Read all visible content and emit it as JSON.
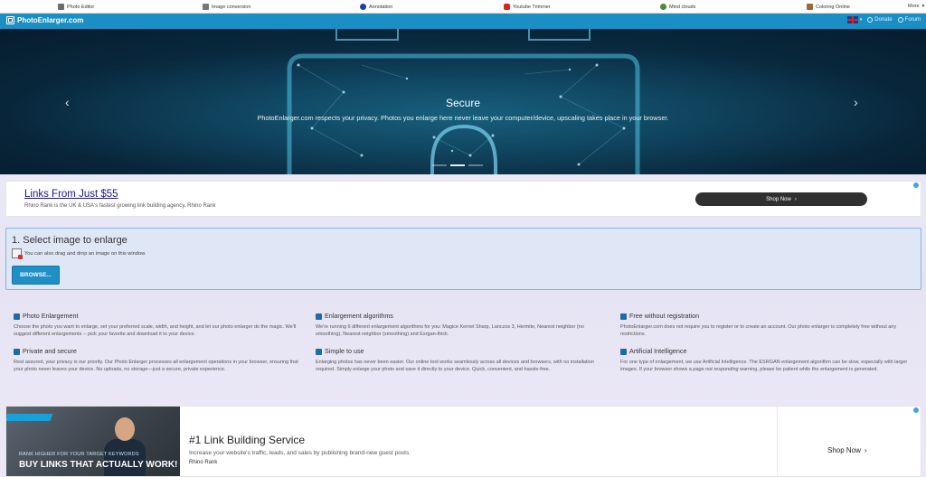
{
  "topbar": {
    "items": [
      {
        "label": "Photo Editor",
        "icon": "photo-editor-icon",
        "color": "#6d6d6d"
      },
      {
        "label": "Image conversion",
        "icon": "image-conversion-icon",
        "color": "#777777"
      },
      {
        "label": "Annotation",
        "icon": "annotation-icon",
        "color": "#1f3fa8"
      },
      {
        "label": "Youtube Trimmer",
        "icon": "youtube-icon",
        "color": "#e02020"
      },
      {
        "label": "Mind clouds",
        "icon": "mind-clouds-icon",
        "color": "#4b8a3b"
      },
      {
        "label": "Coloring Online",
        "icon": "coloring-icon",
        "color": "#9a6b3a"
      }
    ],
    "more_label": "More"
  },
  "header": {
    "brand": "PhotoEnlarger.com",
    "donate_label": "Donate",
    "forum_label": "Forum",
    "accent_color": "#1b8fc4"
  },
  "hero": {
    "title": "Secure",
    "subtitle": "PhotoEnlarger.com respects your privacy. Photos you enlarge here never leave your computer/device, upscaling takes place in your browser."
  },
  "ad_top": {
    "title": "Links From Just $55",
    "subtitle": "Rhino Rank is the UK & USA's fastest growing link building agency. Rhino Rank",
    "button_label": "Shop Now"
  },
  "select_panel": {
    "title": "1. Select image to enlarge",
    "hint": "You can also drag and drop an image on this window.",
    "browse_label": "BROWSE..."
  },
  "features": [
    {
      "title": "Photo Enlargement",
      "icon": "image-icon",
      "text": "Choose the photo you want to enlarge, set your preferred scale, width, and height, and let our photo enlarger do the magic. We'll suggest different enlargements -- pick your favorite and download it to your device."
    },
    {
      "title": "Enlargement algorithms",
      "icon": "image-icon",
      "text": "We're running 6 different enlargement algorithms for you: Magice Kernel Sharp, Lanczos 3, Hermite, Nearest neighbor (no smoothing), Nearest neighbor (smoothing) and Esrgan-thick."
    },
    {
      "title": "Free without registration",
      "icon": "user-icon",
      "text": "PhotoEnlarger.com does not require you to register or to create an account. Our photo enlarger is completely free without any restrictions."
    },
    {
      "title": "Private and secure",
      "icon": "lock-icon",
      "text": "Rest assured, your privacy is our priority. Our Photo Enlarger processes all enlargement operations in your browser, ensuring that your photo never leaves your device. No uploads, no storage—just a secure, private experience."
    },
    {
      "title": "Simple to use",
      "icon": "send-icon",
      "text": "Enlarging photos has never been easier. Our online tool works seamlessly across all devices and browsers, with no installation required. Simply enlarge your photo and save it directly to your device. Quick, convenient, and hassle-free."
    },
    {
      "title": "Artificial Intelligence",
      "icon": "server-icon",
      "text_before": "For one type of enlargement, ",
      "text_em1": "we use",
      "text_mid": " Artificial Intelligence. The ESRGAN enlargement algorithm can be slow, especially with larger images. If your browser shows a ",
      "text_em2": "page not responding",
      "text_after": " warning, please be patient while the enlargement is generated."
    }
  ],
  "ad_bottom": {
    "image_tag": "RANK HIGHER FOR YOUR TARGET KEYWORDS",
    "image_headline": "BUY LINKS THAT ACTUALLY WORK!",
    "title": "#1 Link Building Service",
    "subtitle": "Increase your website's traffic, leads, and sales by publishing brand-new guest posts.",
    "brand": "Rhino Rank",
    "button_label": "Shop Now"
  }
}
